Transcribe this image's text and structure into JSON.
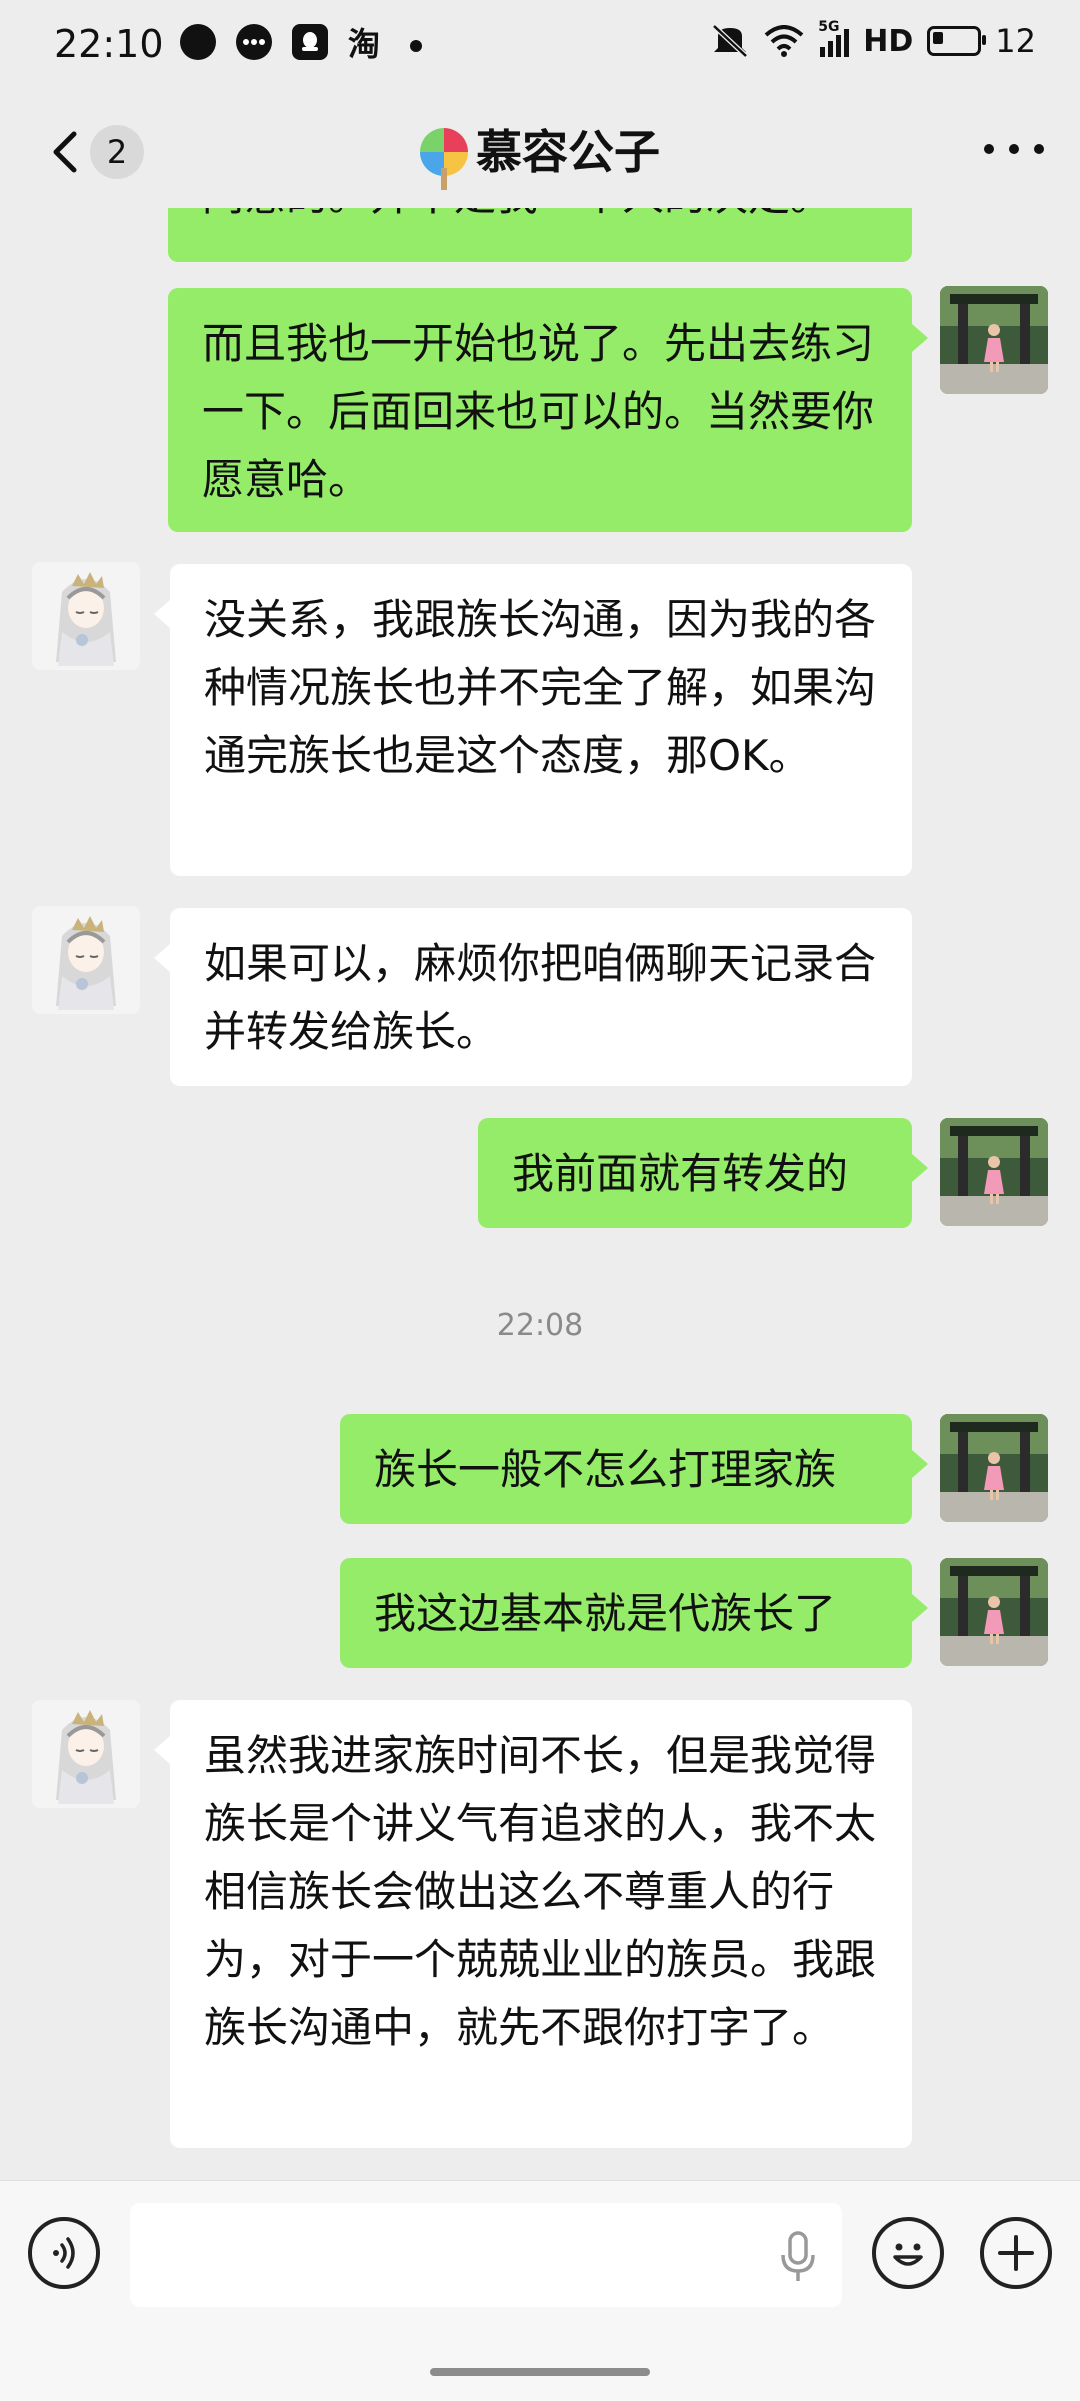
{
  "status_bar": {
    "time": "22:10",
    "notifications": [
      "circle-app-icon",
      "message-icon",
      "qq-icon",
      "taobao-icon"
    ],
    "taobao_label": "淘",
    "network": "5G",
    "hd_label": "HD",
    "battery_level": "12"
  },
  "header": {
    "unread_count": "2",
    "title": "慕容公子",
    "title_emoji": "lollipop-icon"
  },
  "messages": [
    {
      "sender": "me",
      "text": "同意的。并不是我一个人的决定。",
      "partial": true
    },
    {
      "sender": "me",
      "text": "而且我也一开始也说了。先出去练习一下。后面回来也可以的。当然要你愿意哈。"
    },
    {
      "sender": "other",
      "text": "没关系，我跟族长沟通，因为我的各种情况族长也并不完全了解，如果沟通完族长也是这个态度，那OK。"
    },
    {
      "sender": "other",
      "text": "如果可以，麻烦你把咱俩聊天记录合并转发给族长。"
    },
    {
      "sender": "me",
      "text": "我前面就有转发的"
    },
    {
      "timestamp": "22:08"
    },
    {
      "sender": "me",
      "text": "族长一般不怎么打理家族"
    },
    {
      "sender": "me",
      "text": "我这边基本就是代族长了"
    },
    {
      "sender": "other",
      "text": "虽然我进家族时间不长，但是我觉得族长是个讲义气有追求的人，我不太相信族长会做出这么不尊重人的行为，对于一个兢兢业业的族员。我跟族长沟通中，就先不跟你打字了。"
    }
  ],
  "input": {
    "placeholder": "",
    "voice_icon": "voice-icon",
    "mic_icon": "mic-icon",
    "emoji_icon": "emoji-icon",
    "plus_icon": "plus-icon"
  },
  "colors": {
    "my_bubble": "#95ec69",
    "other_bubble": "#ffffff",
    "background": "#ededed"
  }
}
